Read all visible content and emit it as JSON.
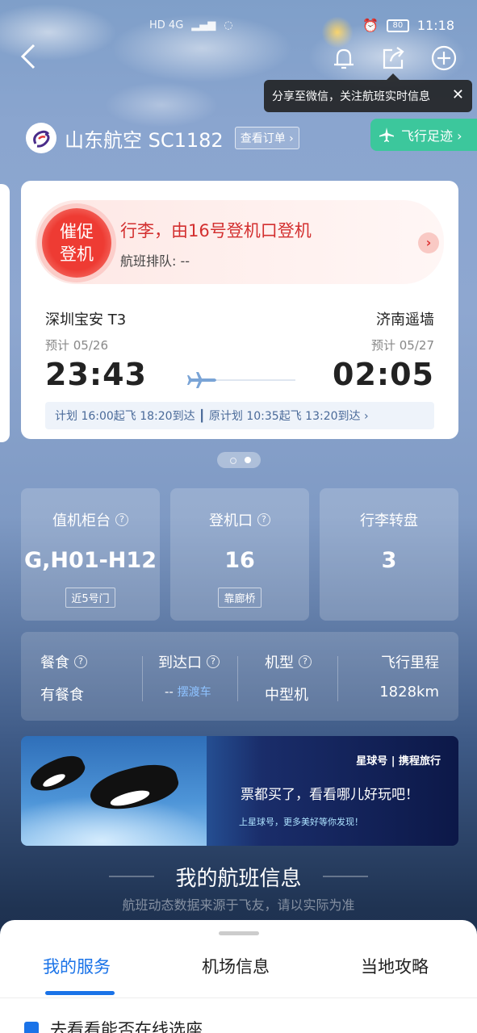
{
  "status_bar": {
    "time": "11:18",
    "battery": "80",
    "network_icons": "HD 4G"
  },
  "nav": {
    "back_icon": "chevron-left-icon",
    "bell_icon": "bell-icon",
    "share_icon": "share-icon",
    "add_icon": "plus-circle-icon"
  },
  "tooltip": {
    "text": "分享至微信，关注航班实时信息",
    "close": "✕"
  },
  "airline": {
    "name": "山东航空 SC1182",
    "order_button": "查看订单 ›"
  },
  "trail_button": {
    "label": "飞行足迹 ›"
  },
  "flight_card": {
    "urge_label_line1": "催促",
    "urge_label_line2": "登机",
    "promo_title": "行李，由16号登机口登机",
    "queue_text": "航班排队: --",
    "departure_city": "深圳宝安 T3",
    "arrival_city": "济南遥墙",
    "departure_date": "预计 05/26",
    "arrival_date": "预计 05/27",
    "departure_time": "23:43",
    "arrival_time": "02:05",
    "plan_text": "计划 16:00起飞 18:20到达 ┃ 原计划 10:35起飞 13:20到达 ›"
  },
  "tiles": [
    {
      "label": "值机柜台",
      "value": "G,H01-H12",
      "tag": "近5号门"
    },
    {
      "label": "登机口",
      "value": "16",
      "tag": "靠廊桥"
    },
    {
      "label": "行李转盘",
      "value": "3",
      "tag": ""
    }
  ],
  "details": {
    "meal_label": "餐食",
    "meal_value": "有餐食",
    "exit_label": "到达口",
    "exit_value": "--",
    "exit_link": "摆渡车",
    "aircraft_label": "机型",
    "aircraft_value": "中型机",
    "distance_label": "飞行里程",
    "distance_value": "1828km"
  },
  "banner": {
    "logo_text": "星球号 | 携程旅行",
    "headline": "票都买了，看看哪儿好玩吧！",
    "subline": "上星球号，更多美好等你发现！"
  },
  "section": {
    "title": "我的航班信息",
    "subtitle": "航班动态数据来源于飞友，请以实际为准"
  },
  "bottom_tabs": {
    "tab1": "我的服务",
    "tab2": "机场信息",
    "tab3": "当地攻略"
  },
  "service_row": {
    "text": "去看看能否在线选座"
  },
  "colors": {
    "accent_blue": "#1a73e8",
    "trail_green": "#3cc79c",
    "urge_red": "#ee3b33"
  }
}
